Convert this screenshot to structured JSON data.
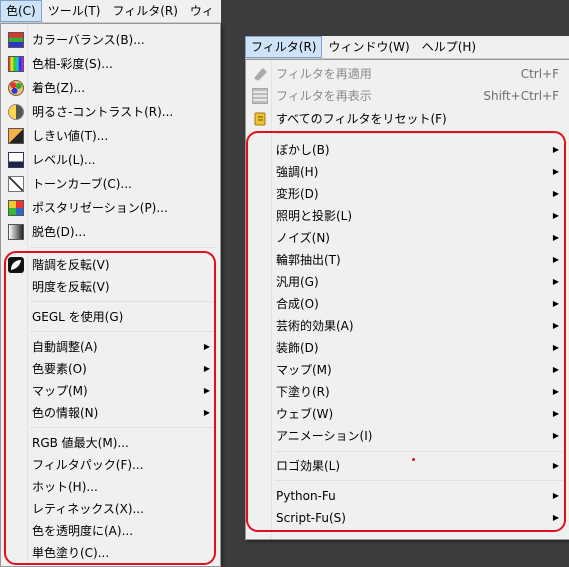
{
  "colors_menubar": {
    "items": [
      "色(C)",
      "ツール(T)",
      "フィルタ(R)",
      "ウィ"
    ]
  },
  "colors_menu": {
    "items": [
      {
        "label": "カラーバランス(B)..."
      },
      {
        "label": "色相-彩度(S)..."
      },
      {
        "label": "着色(Z)..."
      },
      {
        "label": "明るさ-コントラスト(R)..."
      },
      {
        "label": "しきい値(T)..."
      },
      {
        "label": "レベル(L)..."
      },
      {
        "label": "トーンカーブ(C)..."
      },
      {
        "label": "ポスタリゼーション(P)..."
      },
      {
        "label": "脱色(D)..."
      },
      {
        "label": "階調を反転(V)"
      },
      {
        "label": "明度を反転(V)"
      },
      {
        "label": "GEGL を使用(G)"
      },
      {
        "label": "自動調整(A)"
      },
      {
        "label": "色要素(O)"
      },
      {
        "label": "マップ(M)"
      },
      {
        "label": "色の情報(N)"
      },
      {
        "label": "RGB 値最大(M)..."
      },
      {
        "label": "フィルタパック(F)..."
      },
      {
        "label": "ホット(H)..."
      },
      {
        "label": "レティネックス(X)..."
      },
      {
        "label": "色を透明度に(A)..."
      },
      {
        "label": "単色塗り(C)..."
      }
    ]
  },
  "filters_menubar": {
    "items": [
      "フィルタ(R)",
      "ウィンドウ(W)",
      "ヘルプ(H)"
    ]
  },
  "filters_menu": {
    "items": [
      {
        "label": "フィルタを再適用",
        "shortcut": "Ctrl+F"
      },
      {
        "label": "フィルタを再表示",
        "shortcut": "Shift+Ctrl+F"
      },
      {
        "label": "すべてのフィルタをリセット(F)"
      },
      {
        "label": "ぼかし(B)"
      },
      {
        "label": "強調(H)"
      },
      {
        "label": "変形(D)"
      },
      {
        "label": "照明と投影(L)"
      },
      {
        "label": "ノイズ(N)"
      },
      {
        "label": "輪郭抽出(T)"
      },
      {
        "label": "汎用(G)"
      },
      {
        "label": "合成(O)"
      },
      {
        "label": "芸術的効果(A)"
      },
      {
        "label": "装飾(D)"
      },
      {
        "label": "マップ(M)"
      },
      {
        "label": "下塗り(R)"
      },
      {
        "label": "ウェブ(W)"
      },
      {
        "label": "アニメーション(I)"
      },
      {
        "label": "ロゴ効果(L)"
      },
      {
        "label": "Python-Fu"
      },
      {
        "label": "Script-Fu(S)"
      }
    ]
  },
  "submenu_arrow": "▶",
  "highlight_color": "#e0101e"
}
